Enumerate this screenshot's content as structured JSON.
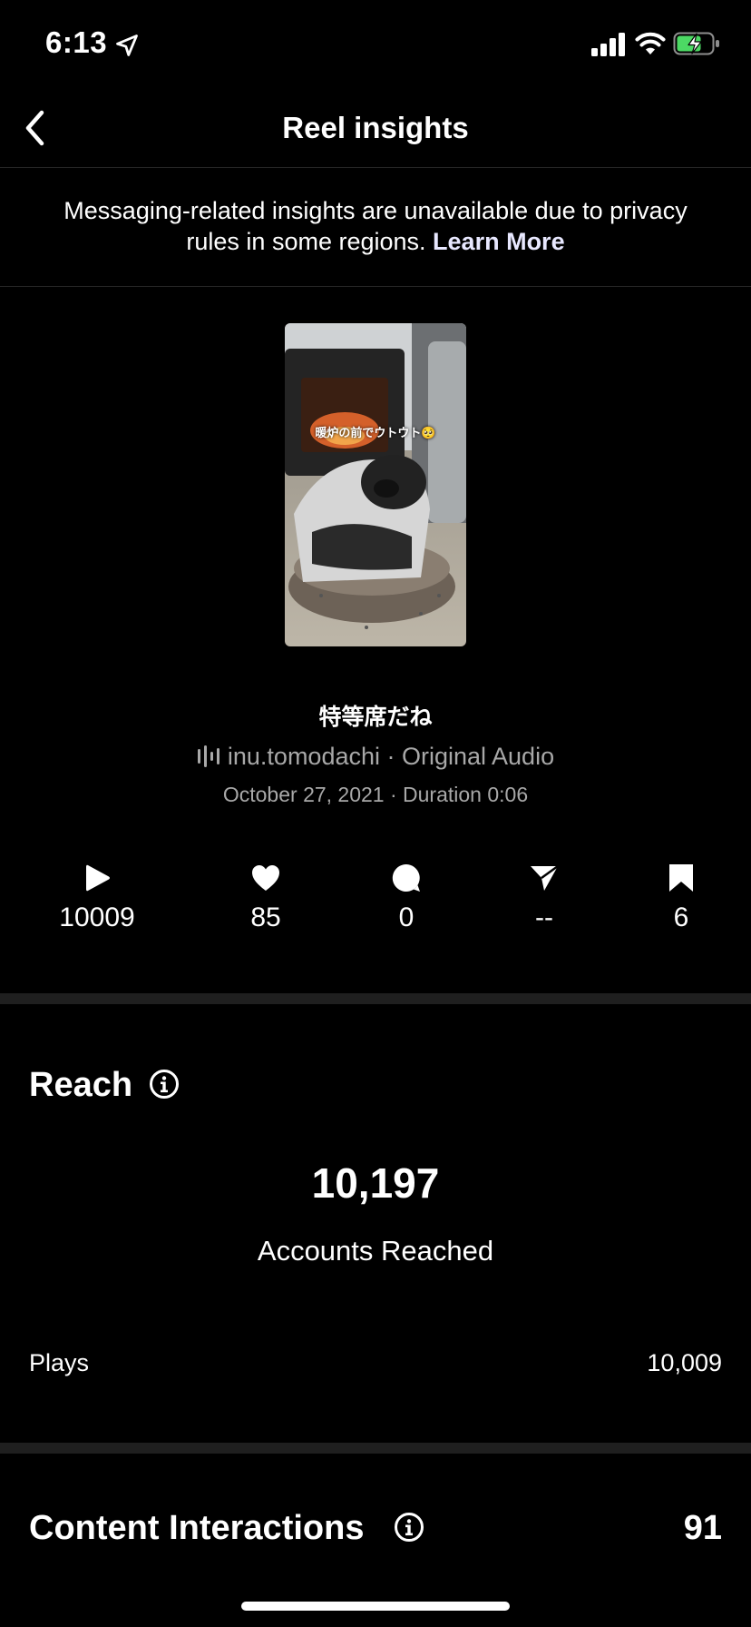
{
  "status_bar": {
    "time": "6:13"
  },
  "nav": {
    "title": "Reel insights"
  },
  "notice": {
    "text": "Messaging-related insights are unavailable due to privacy rules in some regions.",
    "link": "Learn More"
  },
  "reel": {
    "thumbnail_caption": "暖炉の前でウトウト🥺",
    "title": "特等席だね",
    "audio": "inu.tomodachi · Original Audio",
    "meta": "October 27, 2021 · Duration 0:06"
  },
  "stats": [
    {
      "icon": "play-icon",
      "value": "10009"
    },
    {
      "icon": "heart-icon",
      "value": "85"
    },
    {
      "icon": "comment-icon",
      "value": "0"
    },
    {
      "icon": "share-icon",
      "value": "--"
    },
    {
      "icon": "bookmark-icon",
      "value": "6"
    }
  ],
  "reach": {
    "title": "Reach",
    "accounts_reached_value": "10,197",
    "accounts_reached_label": "Accounts Reached",
    "plays_label": "Plays",
    "plays_value": "10,009"
  },
  "content_interactions": {
    "title": "Content Interactions",
    "value": "91"
  }
}
